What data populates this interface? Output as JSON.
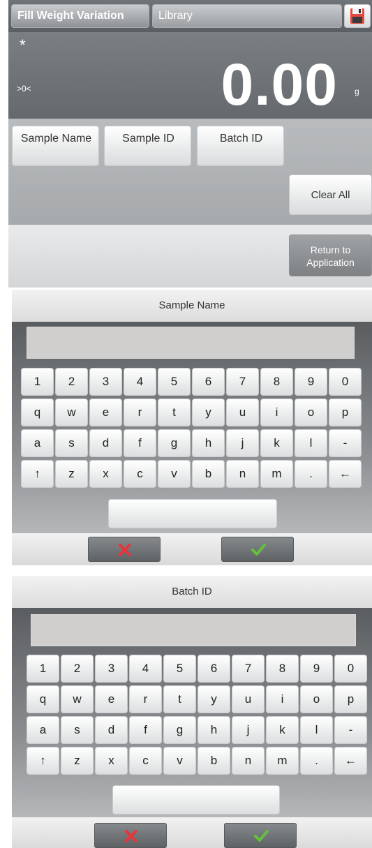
{
  "main": {
    "title_tab": "Fill Weight Variation",
    "library_tab": "Library",
    "save_icon": "floppy-disk-icon",
    "stable_indicator": "*",
    "zero_indicator": ">0<",
    "weight": "0.00",
    "unit": "g",
    "fields": [
      "Sample Name",
      "Sample ID",
      "Batch ID"
    ],
    "clear_all": "Clear All",
    "return_line1": "Return to",
    "return_line2": "Application"
  },
  "keyboards": [
    {
      "title": "Sample Name",
      "input_value": ""
    },
    {
      "title": "Batch ID",
      "input_value": ""
    }
  ],
  "keys": {
    "row1": [
      "1",
      "2",
      "3",
      "4",
      "5",
      "6",
      "7",
      "8",
      "9",
      "0"
    ],
    "row2": [
      "q",
      "w",
      "e",
      "r",
      "t",
      "y",
      "u",
      "i",
      "o",
      "p"
    ],
    "row3": [
      "a",
      "s",
      "d",
      "f",
      "g",
      "h",
      "j",
      "k",
      "l",
      "-"
    ],
    "row4": [
      "↑",
      "z",
      "x",
      "c",
      "v",
      "b",
      "n",
      "m",
      ".",
      "←"
    ]
  },
  "icons": {
    "cancel": "red-x-icon",
    "confirm": "green-check-icon"
  },
  "colors": {
    "cancel": "#e8343a",
    "confirm": "#63c23b"
  }
}
